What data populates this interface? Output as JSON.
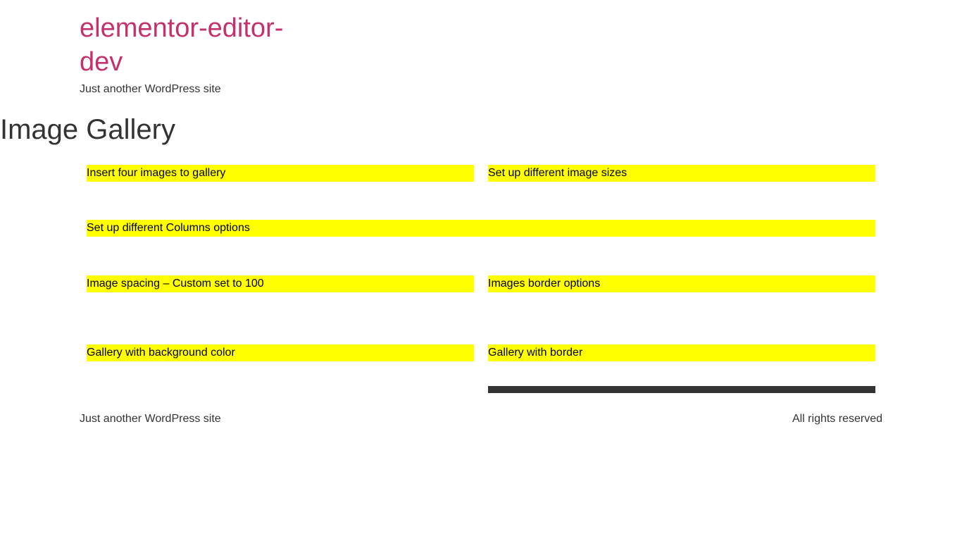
{
  "header": {
    "site_title": "elementor-editor-dev",
    "site_description": "Just another WordPress site"
  },
  "page": {
    "title": "Image Gallery"
  },
  "sections": {
    "insert_images": "Insert four images to gallery",
    "image_sizes": "Set up different image sizes",
    "columns_options": "Set up different Columns options",
    "image_spacing": "Image spacing – Custom set to 100",
    "border_options": "Images border options",
    "background_color": "Gallery with background color",
    "with_border": "Gallery with border"
  },
  "footer": {
    "left_text": "Just another WordPress site",
    "right_text": "All rights reserved"
  },
  "colors": {
    "site_title": "#c5316c",
    "section_highlight": "#ffff00",
    "text": "#333333",
    "border_bar": "#333333"
  }
}
